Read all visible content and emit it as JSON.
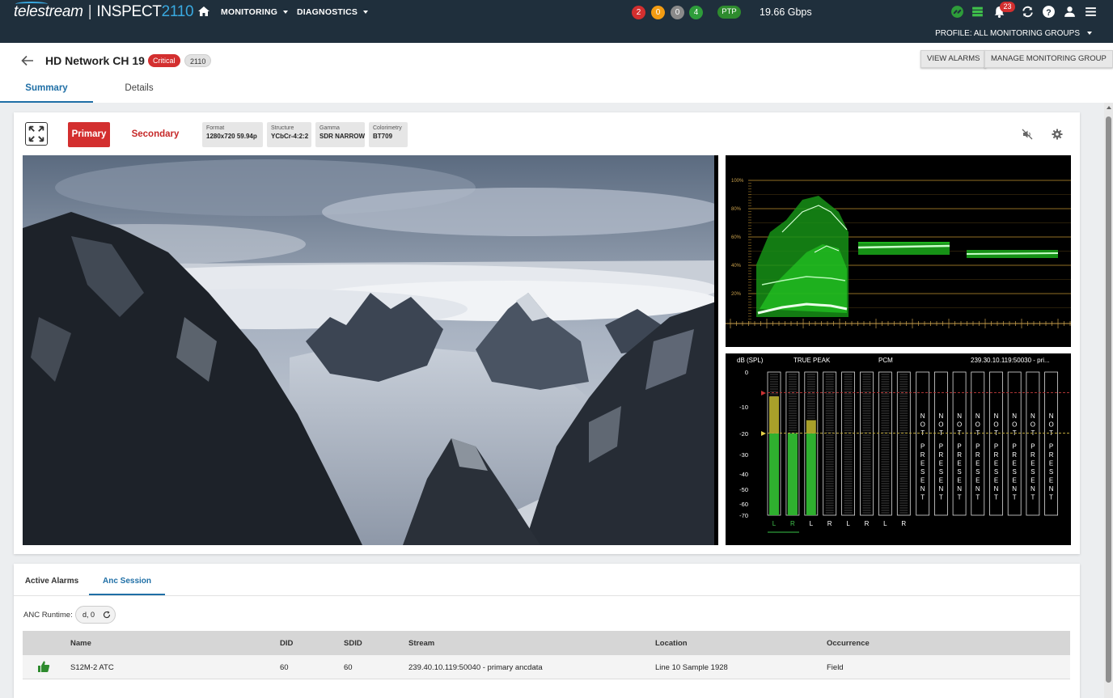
{
  "app": {
    "brand": "telestream",
    "product_prefix": "INSPECT",
    "product_number": "2110"
  },
  "nav": {
    "monitoring": "MONITORING",
    "diagnostics": "DIAGNOSTICS"
  },
  "status_counts": [
    {
      "value": "2",
      "color": "#d32f2f"
    },
    {
      "value": "0",
      "color": "#f39c12"
    },
    {
      "value": "0",
      "color": "#8a8a8a"
    },
    {
      "value": "4",
      "color": "#2e9d3a"
    }
  ],
  "ptp_label": "PTP",
  "bandwidth": "19.66 Gbps",
  "notifications_count": "23",
  "profile_label": "PROFILE: ALL MONITORING GROUPS",
  "header": {
    "title": "HD Network CH 19",
    "severity": "Critical",
    "standard": "2110",
    "view_alarms": "VIEW ALARMS",
    "manage_group": "MANAGE MONITORING GROUP",
    "tabs": [
      "Summary",
      "Details"
    ]
  },
  "stream": {
    "primary": "Primary",
    "secondary": "Secondary",
    "info": [
      {
        "key": "Format",
        "value": "1280x720 59.94p"
      },
      {
        "key": "Structure",
        "value": "YCbCr-4:2:2"
      },
      {
        "key": "Gamma",
        "value": "SDR NARROW"
      },
      {
        "key": "Colorimetry",
        "value": "BT709"
      }
    ]
  },
  "waveform": {
    "scale_labels": [
      "100%",
      "80%",
      "60%",
      "40%",
      "20%"
    ],
    "trace_color": "#27d427"
  },
  "audio_meter": {
    "unit_label": "dB (SPL)",
    "mode_label": "TRUE PEAK",
    "format_label": "PCM",
    "source": "239.30.10.119:50030 - pri...",
    "scale": [
      "0",
      "-10",
      "-20",
      "-30",
      "-40",
      "-50",
      "-60",
      "-70"
    ],
    "channels": [
      {
        "label": "L",
        "level_db": -7
      },
      {
        "label": "R",
        "level_db": -23
      },
      {
        "label": "L",
        "level_db": -15
      },
      {
        "label": "R",
        "level_db": null
      },
      {
        "label": "L",
        "level_db": null
      },
      {
        "label": "R",
        "level_db": null
      },
      {
        "label": "L",
        "level_db": null
      },
      {
        "label": "R",
        "level_db": null
      }
    ],
    "not_present_count": 8,
    "not_present_text": "NOT PRESENT"
  },
  "bottom": {
    "tabs": [
      "Active Alarms",
      "Anc Session"
    ],
    "anc_runtime_label": "ANC Runtime:",
    "anc_runtime_value": "d, 0",
    "columns": [
      "Name",
      "DID",
      "SDID",
      "Stream",
      "Location",
      "Occurrence"
    ],
    "rows": [
      {
        "name": "S12M-2 ATC",
        "did": "60",
        "sdid": "60",
        "stream": "239.40.10.119:50040 - primary ancdata",
        "location": "Line 10 Sample 1928",
        "occurrence": "Field"
      }
    ]
  }
}
